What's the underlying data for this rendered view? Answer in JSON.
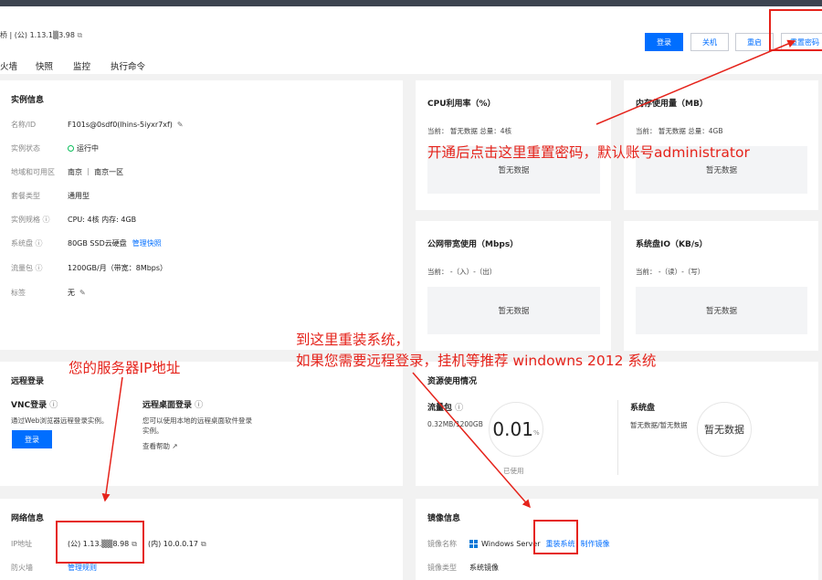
{
  "header": {
    "title": "桥 | (公) 1.13.1▒3.98",
    "tabs": [
      "火墙",
      "快照",
      "监控",
      "执行命令"
    ],
    "buttons": {
      "login": "登录",
      "shutdown": "关机",
      "restart": "重启",
      "reset_password": "重置密码"
    }
  },
  "instance": {
    "title": "实例信息",
    "rows": [
      {
        "label": "名称/ID",
        "value": "F101s@0sdf0(lhins-5iyxr7xf)"
      },
      {
        "label": "实例状态",
        "value": "运行中"
      },
      {
        "label": "地域和可用区",
        "value": "南京 ｜ 南京一区"
      },
      {
        "label": "套餐类型",
        "value": "通用型"
      },
      {
        "label": "实例规格",
        "value": "CPU: 4核 内存: 4GB"
      },
      {
        "label": "系统盘",
        "value": "80GB SSD云硬盘",
        "link": "管理快照"
      },
      {
        "label": "流量包",
        "value": "1200GB/月（带宽：8Mbps）"
      },
      {
        "label": "标签",
        "value": "无"
      }
    ]
  },
  "metrics": [
    {
      "title": "CPU利用率（%）",
      "current": "当前：  暂无数据 总量：4核",
      "nodata": "暂无数据"
    },
    {
      "title": "内存使用量（MB）",
      "current": "当前：  暂无数据 总量：4GB",
      "nodata": "暂无数据"
    },
    {
      "title": "公网带宽使用（Mbps）",
      "current": "当前：  -（入）-（出）",
      "nodata": "暂无数据"
    },
    {
      "title": "系统盘IO（KB/s）",
      "current": "当前：  -（读）-（写）",
      "nodata": "暂无数据"
    }
  ],
  "remote": {
    "title": "远程登录",
    "vnc_title": "VNC登录",
    "vnc_desc": "通过Web浏览器远程登录实例。",
    "vnc_button": "登录",
    "rdp_title": "远程桌面登录",
    "rdp_desc_1": "您可以使用本地的远程桌面软件登录",
    "rdp_desc_2": "实例。",
    "rdp_link": "查看帮助"
  },
  "resource": {
    "title": "资源使用情况",
    "traffic_title": "流量包",
    "traffic_value": "0.32MB/1200GB",
    "traffic_percent": "0.01",
    "traffic_percent_unit": "%",
    "traffic_used_label": "已使用",
    "disk_title": "系统盘",
    "disk_value": "暂无数据/暂无数据",
    "disk_nodata": "暂无数据"
  },
  "network": {
    "title": "网络信息",
    "ip_label": "IP地址",
    "public_ip": "(公) 1.13.▒▒8.98",
    "private_ip": "(内) 10.0.0.17",
    "firewall_label": "防火墙",
    "firewall_link": "管理规则"
  },
  "image": {
    "title": "镜像信息",
    "name_label": "镜像名称",
    "name_value": "Windows Server",
    "reinstall_link": "重装系统",
    "make_image_link": "制作镜像",
    "type_label": "镜像类型",
    "type_value": "系统镜像"
  },
  "annotations": {
    "reset_hint": "开通后点击这里重置密码，默认账号administrator",
    "ip_hint": "您的服务器IP地址",
    "reinstall_hint_1": "到这里重装系统，",
    "reinstall_hint_2": "如果您需要远程登录，挂机等推荐 windowns 2012 系统"
  },
  "colors": {
    "accent": "#006eff",
    "annotation": "#e5231b",
    "running": "#0abf5b"
  }
}
